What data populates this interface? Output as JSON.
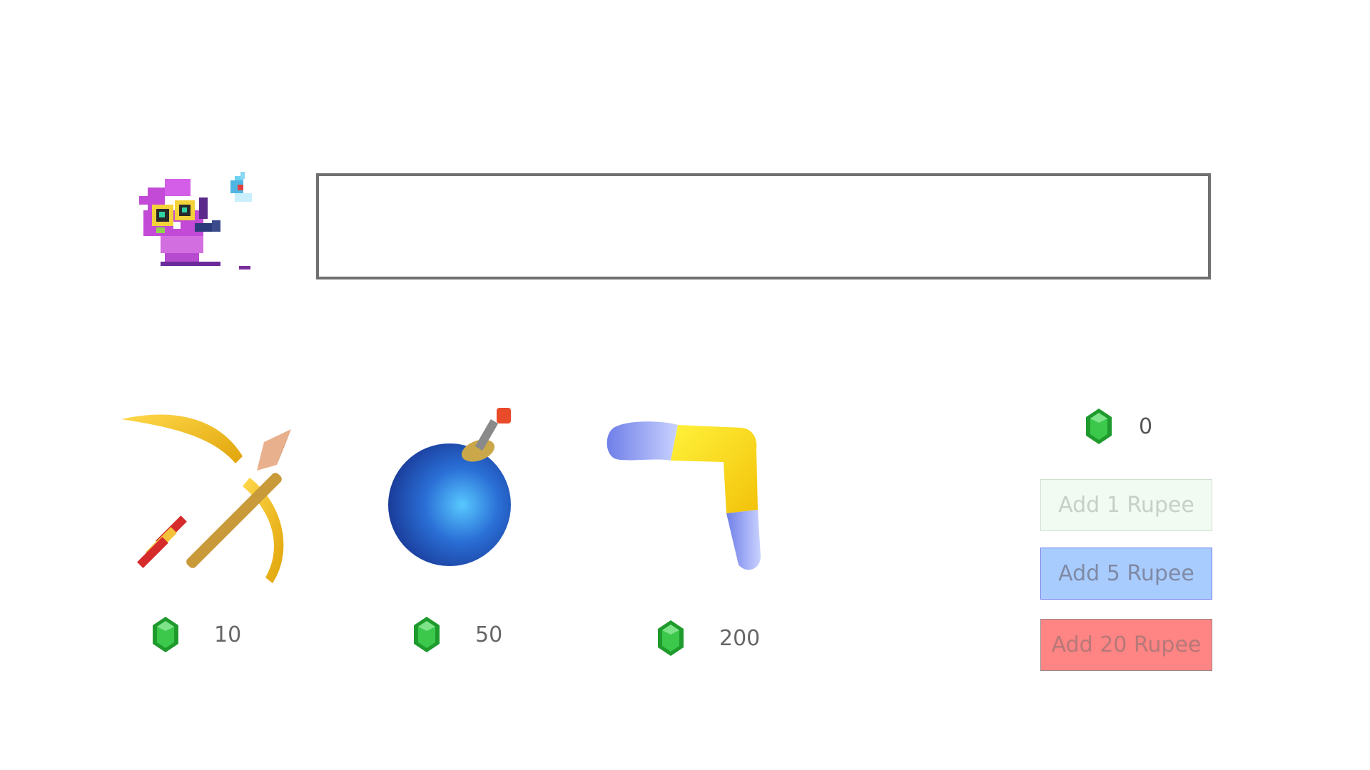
{
  "shop": {
    "items": [
      {
        "name": "bow-and-arrow",
        "price": "10"
      },
      {
        "name": "bomb",
        "price": "50"
      },
      {
        "name": "boomerang",
        "price": "200"
      }
    ]
  },
  "wallet": {
    "balance": "0"
  },
  "buttons": {
    "add1": "Add 1 Rupee",
    "add5": "Add 5 Rupee",
    "add20": "Add 20 Rupee"
  },
  "message_box": {
    "text": ""
  },
  "colors": {
    "rupee_green": "#1f9a2c",
    "add1_bg": "#f1fbf1",
    "add5_bg": "#a9ccff",
    "add20_bg": "#ff8484"
  }
}
